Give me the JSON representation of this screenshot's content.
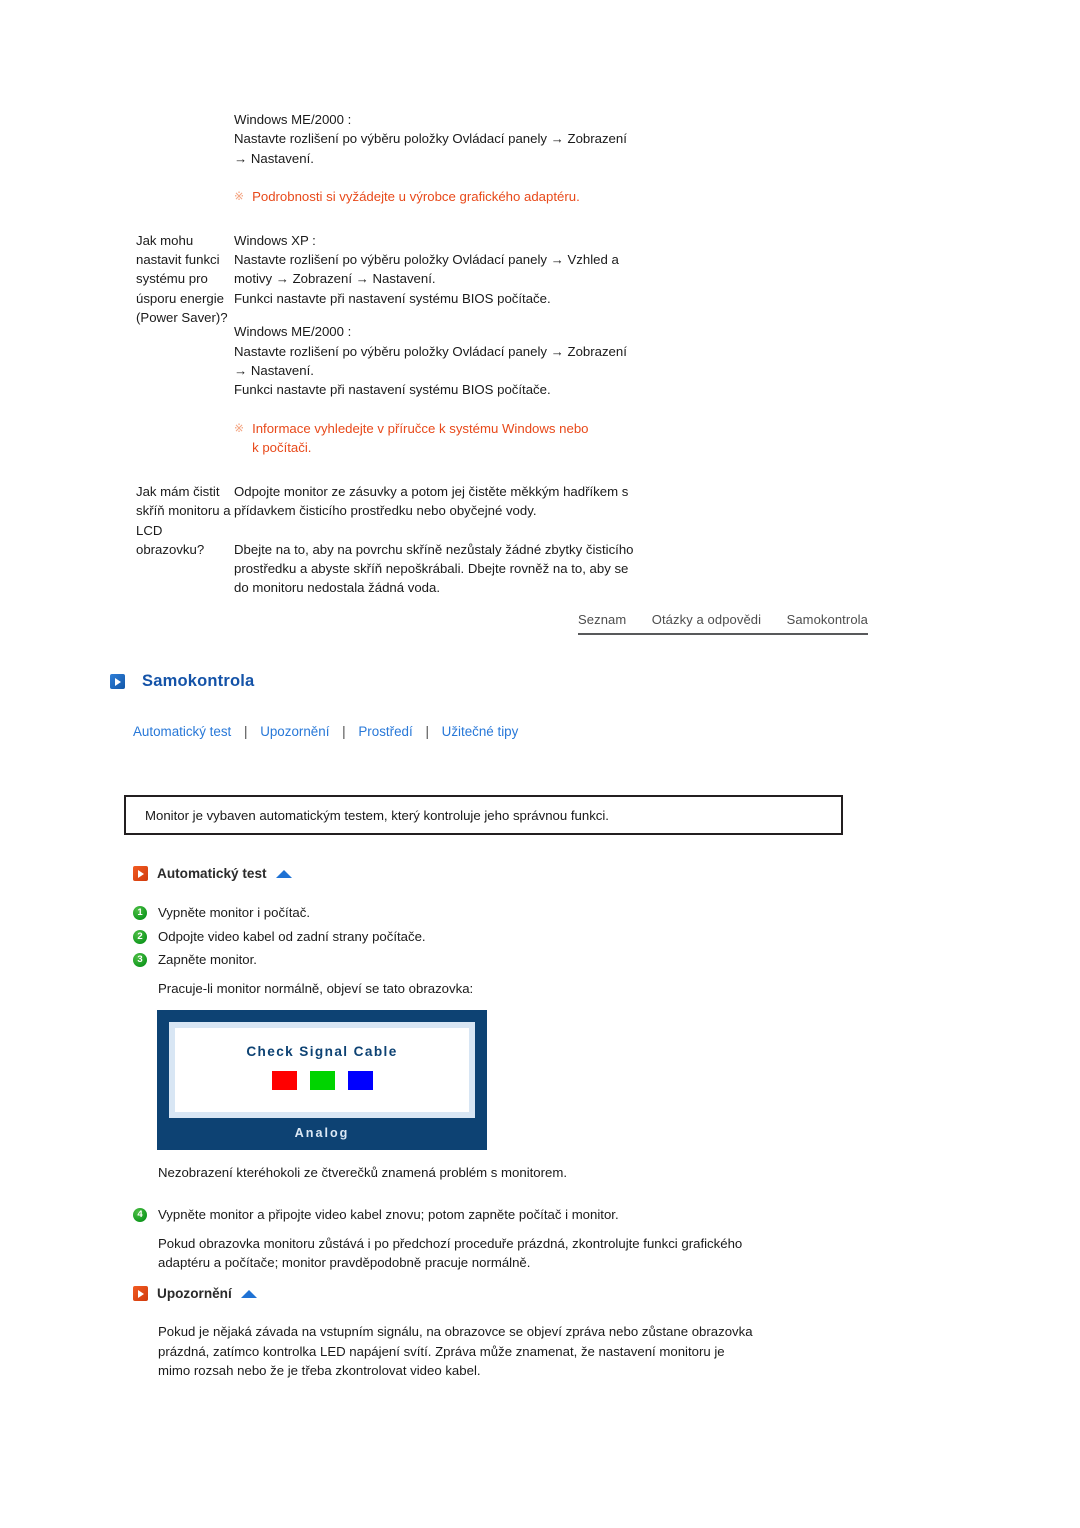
{
  "faq": {
    "rows": [
      {
        "question": "",
        "answer_blocks": [
          {
            "type": "lines",
            "lines": [
              "Windows ME/2000 :",
              "Nastavte rozlišení po výběru položky Ovládací panely → Zobrazení",
              "→ Nastavení."
            ]
          },
          {
            "type": "note",
            "mark": "※",
            "lines": [
              "Podrobnosti si vyžádejte u výrobce grafického adaptéru."
            ]
          }
        ]
      },
      {
        "question_lines": [
          "Jak mohu nastavit funkci",
          "systému pro úsporu energie",
          "(Power Saver)?"
        ],
        "answer_blocks": [
          {
            "type": "lines",
            "lines": [
              "Windows XP :",
              "Nastavte rozlišení po výběru položky Ovládací panely → Vzhled a",
              "motivy → Zobrazení → Nastavení.",
              "Funkci nastavte při nastavení systému BIOS počítače."
            ]
          },
          {
            "type": "lines",
            "lines": [
              "Windows ME/2000 :",
              "Nastavte rozlišení po výběru položky Ovládací panely → Zobrazení",
              "→ Nastavení.",
              "Funkci nastavte při nastavení systému BIOS počítače."
            ]
          },
          {
            "type": "note",
            "mark": "※",
            "lines": [
              "Informace vyhledejte v příručce k systému Windows nebo",
              "k počítači."
            ]
          }
        ]
      },
      {
        "question_lines": [
          "Jak mám čistit skříň monitoru a",
          "LCD obrazovku?"
        ],
        "answer_blocks": [
          {
            "type": "lines",
            "lines": [
              "Odpojte monitor ze zásuvky a potom jej čistěte měkkým hadříkem s",
              "přídavkem čisticího prostředku nebo obyčejné vody."
            ]
          },
          {
            "type": "lines",
            "lines": [
              "Dbejte na to, aby na povrchu skříně nezůstaly žádné zbytky čisticího",
              "prostředku a abyste skříň nepoškrábali. Dbejte rovněž na to, aby se",
              "do monitoru nedostala žádná voda."
            ]
          }
        ]
      }
    ]
  },
  "crumbs": {
    "items": [
      "Seznam",
      "Otázky a odpovědi",
      "Samokontrola"
    ]
  },
  "section": {
    "icon": "blue-play-square-icon",
    "title": "Samokontrola"
  },
  "subnav": {
    "items": [
      "Automatický test",
      "Upozornění",
      "Prostředí",
      "Užitečné tipy"
    ],
    "separator": "|"
  },
  "intro": {
    "text": "Monitor je vybaven automatickým testem, který kontroluje jeho správnou funkci."
  },
  "autotest": {
    "heading": "Automatický test",
    "steps": [
      {
        "n": "1",
        "text": "Vypněte monitor i počítač."
      },
      {
        "n": "2",
        "text": "Odpojte video kabel od zadní strany počítače."
      },
      {
        "n": "3",
        "text": "Zapněte monitor."
      }
    ],
    "after_steps": "Pracuje-li monitor normálně, objeví se tato obrazovka:",
    "screen": {
      "title": "Check Signal Cable",
      "label": "Analog",
      "swatch_colors": [
        "#ff0000",
        "#00d400",
        "#0000ff"
      ]
    },
    "after_image": "Nezobrazení kteréhokoli ze čtverečků znamená problém s monitorem.",
    "step4": {
      "n": "4",
      "text": "Vypněte monitor a připojte video kabel znovu; potom zapněte počítač i monitor."
    },
    "step4_note_lines": [
      "Pokud obrazovka monitoru zůstává i po předchozí proceduře prázdná, zkontrolujte funkci grafického",
      "adaptéru a počítače; monitor pravděpodobně pracuje normálně."
    ]
  },
  "warning": {
    "heading": "Upozornění",
    "lines": [
      "Pokud je nějaká závada na vstupním signálu, na obrazovce se objeví zpráva nebo zůstane obrazovka",
      "prázdná, zatímco kontrolka LED napájení svítí. Zpráva může znamenat, že nastavení monitoru je",
      "mimo rozsah nebo že je třeba zkontrolovat video kabel."
    ]
  },
  "colors": {
    "link": "#2878d8",
    "heading": "#1453a8",
    "note": "#e8491a",
    "step_bullet": "#129a1f",
    "monitor_frame": "#0d4273"
  }
}
